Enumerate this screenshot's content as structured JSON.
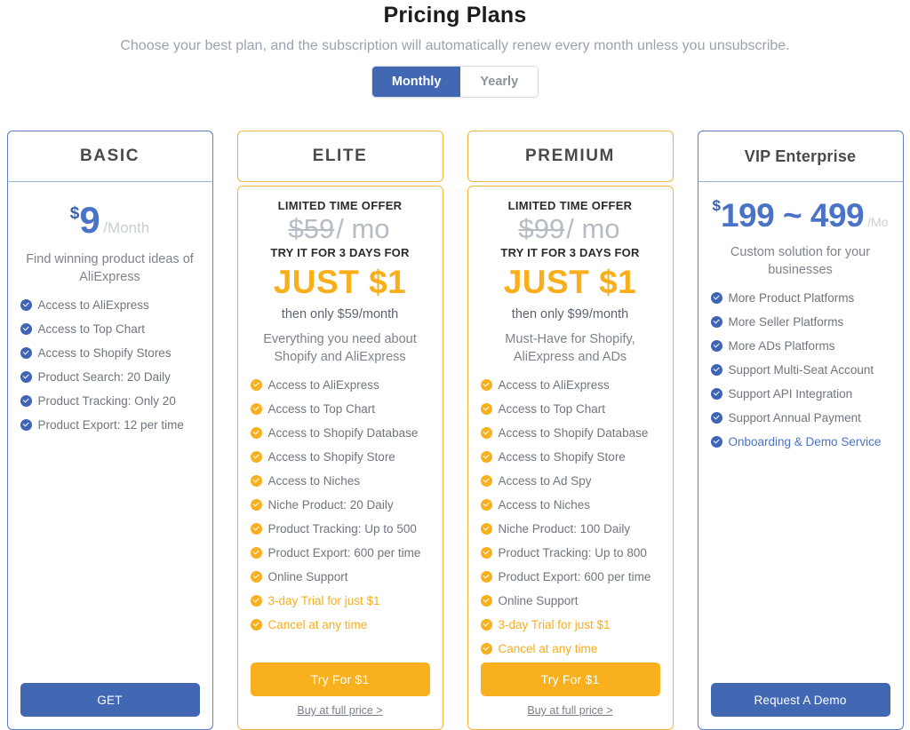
{
  "header": {
    "title": "Pricing Plans",
    "subtitle": "Choose your best plan, and the subscription will automatically renew every month unless you unsubscribe."
  },
  "billing_toggle": {
    "monthly_label": "Monthly",
    "yearly_label": "Yearly",
    "selected": "Monthly"
  },
  "colors": {
    "blue": "#4268b4",
    "blue_border": "#5a7fc4",
    "orange": "#f9b01e",
    "orange_border": "#f2b544",
    "muted_text": "#6f757e",
    "old_price_gray": "#b6bcc4"
  },
  "plans": [
    {
      "id": "basic",
      "theme": "blue",
      "name": "BASIC",
      "price_currency": "$",
      "price_amount": "9",
      "price_period": "/Month",
      "tagline": "Find winning product ideas of AliExpress",
      "features": [
        {
          "text": "Access to AliExpress",
          "highlight": false
        },
        {
          "text": "Access to Top Chart",
          "highlight": false
        },
        {
          "text": "Access to Shopify Stores",
          "highlight": false
        },
        {
          "text": "Product Search: 20 Daily",
          "highlight": false
        },
        {
          "text": "Product Tracking: Only 20",
          "highlight": false
        },
        {
          "text": "Product Export: 12 per time",
          "highlight": false
        }
      ],
      "cta_label": "GET",
      "secondary_link": null
    },
    {
      "id": "elite",
      "theme": "orange",
      "name": "ELITE",
      "limited_label": "LIMITED TIME OFFER",
      "old_price": "$59",
      "old_price_period": "/ mo",
      "try_label": "TRY IT FOR 3 DAYS FOR",
      "just_label": "JUST $1",
      "then_only": "then only $59/month",
      "tagline": "Everything you need about Shopify and AliExpress",
      "features": [
        {
          "text": "Access to AliExpress",
          "highlight": false
        },
        {
          "text": "Access to Top Chart",
          "highlight": false
        },
        {
          "text": "Access to Shopify Database",
          "highlight": false
        },
        {
          "text": "Access to Shopify Store",
          "highlight": false
        },
        {
          "text": "Access to Niches",
          "highlight": false
        },
        {
          "text": "Niche Product: 20 Daily",
          "highlight": false
        },
        {
          "text": "Product Tracking: Up to 500",
          "highlight": false
        },
        {
          "text": "Product Export: 600 per time",
          "highlight": false
        },
        {
          "text": "Online Support",
          "highlight": false
        },
        {
          "text": "3-day Trial for just $1",
          "highlight": true
        },
        {
          "text": "Cancel at any time",
          "highlight": true
        }
      ],
      "cta_label": "Try For $1",
      "secondary_link": "Buy at full price >"
    },
    {
      "id": "premium",
      "theme": "orange",
      "name": "PREMIUM",
      "limited_label": "LIMITED TIME OFFER",
      "old_price": "$99",
      "old_price_period": "/ mo",
      "try_label": "TRY IT FOR 3 DAYS FOR",
      "just_label": "JUST $1",
      "then_only": "then only $99/month",
      "tagline": "Must-Have for Shopify, AliExpress and ADs",
      "features": [
        {
          "text": "Access to AliExpress",
          "highlight": false
        },
        {
          "text": "Access to Top Chart",
          "highlight": false
        },
        {
          "text": "Access to Shopify Database",
          "highlight": false
        },
        {
          "text": "Access to Shopify Store",
          "highlight": false
        },
        {
          "text": "Access to Ad Spy",
          "highlight": false
        },
        {
          "text": "Access to Niches",
          "highlight": false
        },
        {
          "text": "Niche Product: 100 Daily",
          "highlight": false
        },
        {
          "text": "Product Tracking: Up to 800",
          "highlight": false
        },
        {
          "text": "Product Export: 600 per time",
          "highlight": false
        },
        {
          "text": "Online Support",
          "highlight": false
        },
        {
          "text": "3-day Trial for just $1",
          "highlight": true
        },
        {
          "text": "Cancel at any time",
          "highlight": true
        }
      ],
      "cta_label": "Try For $1",
      "secondary_link": "Buy at full price >"
    },
    {
      "id": "vip",
      "theme": "blue",
      "name": "VIP Enterprise",
      "price_currency": "$",
      "price_amount": "199 ~ 499",
      "price_period": "/Mo",
      "tagline": "Custom solution for your businesses",
      "features": [
        {
          "text": "More Product Platforms",
          "highlight": false
        },
        {
          "text": "More Seller Platforms",
          "highlight": false
        },
        {
          "text": "More ADs Platforms",
          "highlight": false
        },
        {
          "text": "Support Multi-Seat Account",
          "highlight": false
        },
        {
          "text": "Support API Integration",
          "highlight": false
        },
        {
          "text": "Support Annual Payment",
          "highlight": false
        },
        {
          "text": "Onboarding & Demo Service",
          "highlight": true
        }
      ],
      "cta_label": "Request A Demo",
      "secondary_link": null
    }
  ]
}
